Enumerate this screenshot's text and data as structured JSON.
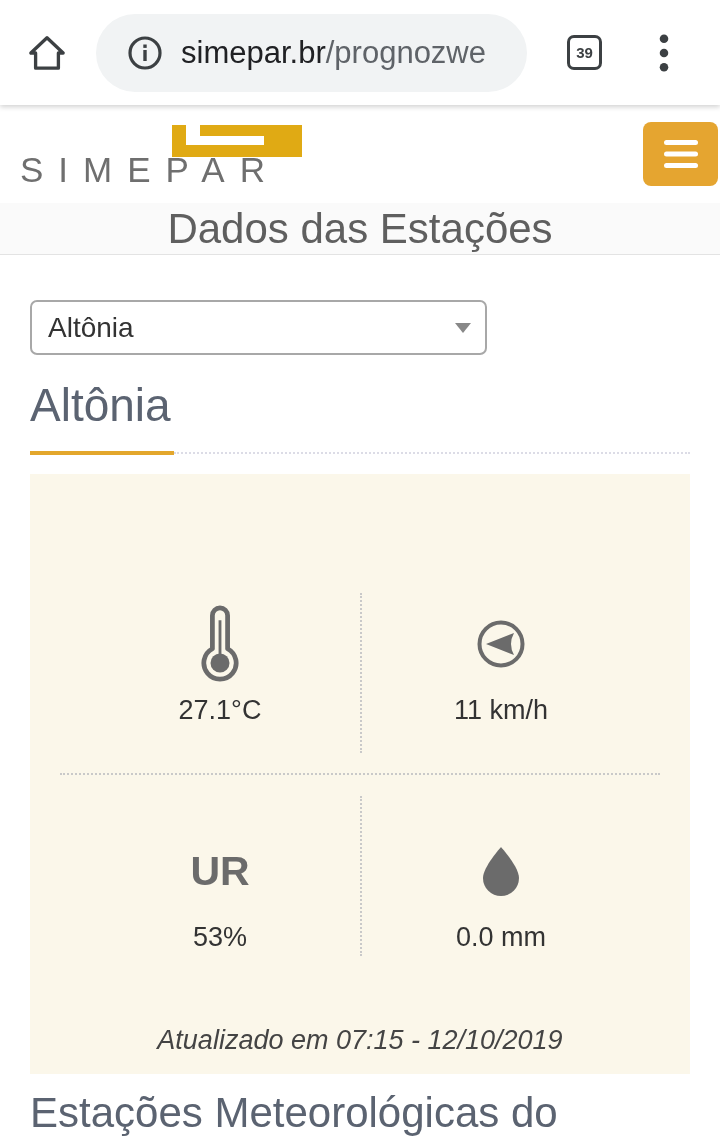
{
  "browser": {
    "url_host": "simepar.br",
    "url_path": "/prognozwe",
    "tab_count": "39"
  },
  "site_header": {
    "logo_text": "SIMEPAR"
  },
  "page_title": "Dados das Estações",
  "station_select": {
    "value": "Altônia"
  },
  "station": {
    "name": "Altônia",
    "metrics": [
      {
        "kind": "temperature",
        "value": "27.1°C"
      },
      {
        "kind": "wind",
        "value": "11 km/h"
      },
      {
        "kind": "label",
        "label": "UR",
        "value": "53%"
      },
      {
        "kind": "rain",
        "value": "0.0 mm"
      }
    ],
    "updated": "Atualizado em 07:15 - 12/10/2019"
  },
  "section_heading": "Estações Meteorológicas do"
}
